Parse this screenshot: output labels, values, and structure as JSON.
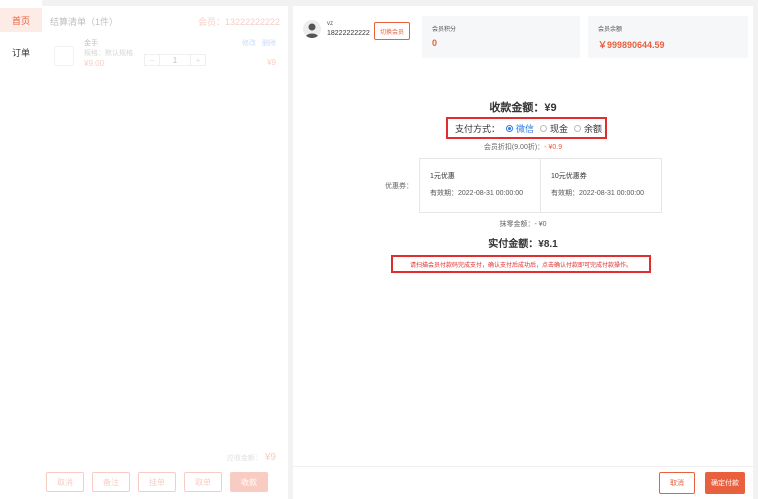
{
  "nav": {
    "items": [
      {
        "label": "首页"
      },
      {
        "label": "订单"
      }
    ]
  },
  "cart": {
    "title": "结算清单（1件）",
    "member_label": "会员：13222222222",
    "item": {
      "name": "金手",
      "spec": "规格：默认规格",
      "price": "¥9.00",
      "edit": "修改",
      "delete": "删除",
      "quantity": "1",
      "minus": "−",
      "plus": "+",
      "total": "¥9"
    },
    "due_label": "应收金额：",
    "due_amount": "¥9",
    "buttons": {
      "cancel": "取消",
      "note": "备注",
      "pending": "挂单",
      "take": "取单",
      "collect": "收款"
    }
  },
  "payment": {
    "member_name": "vz",
    "member_phone": "18222222222",
    "switch_member": "切换会员",
    "points_label": "会员积分",
    "points_value": "0",
    "balance_label": "会员余额",
    "balance_value": "￥999890644.59",
    "collect_amount": "收款金额：¥9",
    "pay_method_label": "支付方式：",
    "methods": [
      {
        "label": "微信"
      },
      {
        "label": "现金"
      },
      {
        "label": "余额"
      }
    ],
    "discount_text": "会员折扣(9.00折)：",
    "discount_value": "- ¥0.9",
    "coupon_label": "优惠券：",
    "coupons": [
      {
        "title": "1元优惠",
        "expiry": "有效期：2022-08-31 00:00:00"
      },
      {
        "title": "10元优惠券",
        "expiry": "有效期：2022-08-31 00:00:00"
      }
    ],
    "wipe_text": "抹零金额：- ¥0",
    "actual_amount": "实付金额：¥8.1",
    "warning": "请扫描会员付款码完成支付，确认支付后成功后，点击确认付款即可完成付款操作。",
    "cancel": "取消",
    "confirm": "确定付款"
  },
  "colors": {
    "accent": "#e9603f",
    "highlight": "#e02d2d",
    "link": "#2d7be0"
  }
}
